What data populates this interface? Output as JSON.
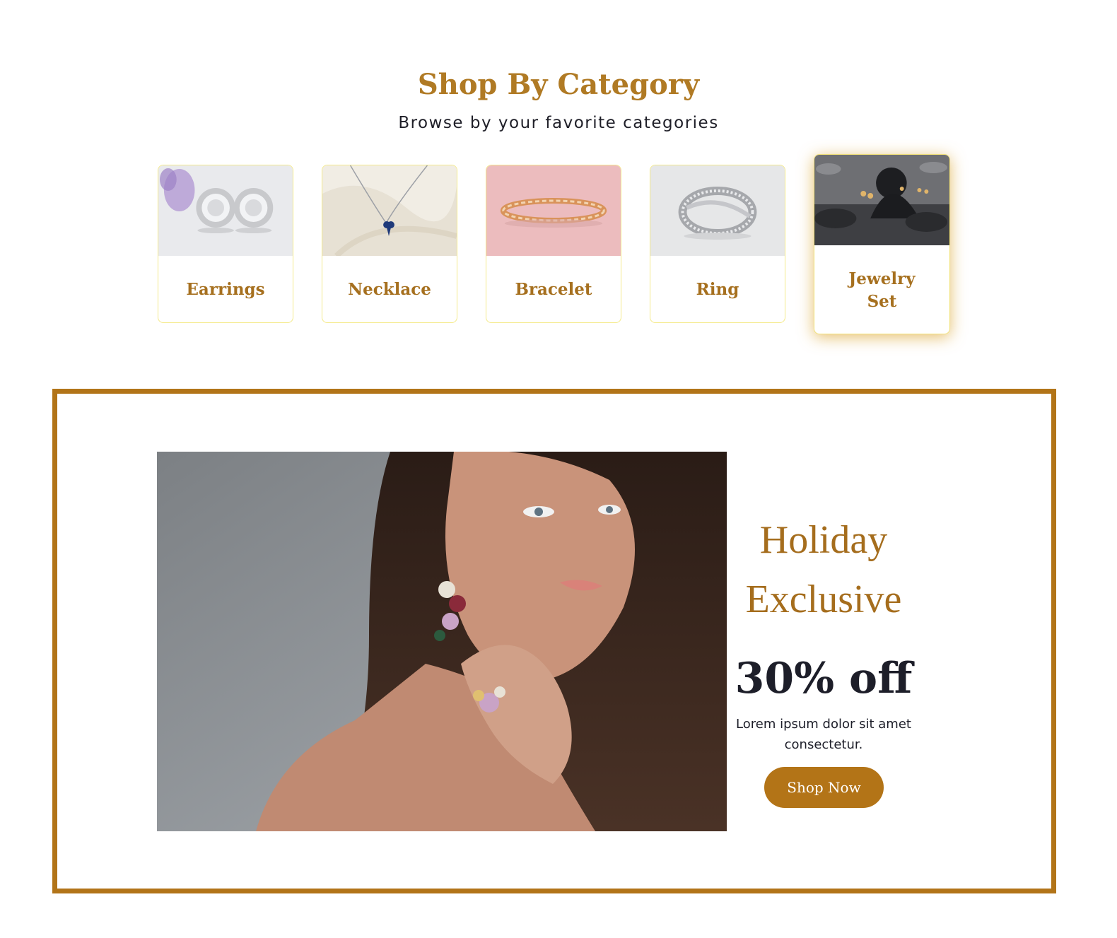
{
  "section": {
    "title": "Shop By Category",
    "subtitle": "Browse by your favorite categories"
  },
  "categories": [
    {
      "label": "Earrings",
      "image": "earrings-photo"
    },
    {
      "label": "Necklace",
      "image": "necklace-photo"
    },
    {
      "label": "Bracelet",
      "image": "bracelet-photo"
    },
    {
      "label": "Ring",
      "image": "ring-photo"
    },
    {
      "label": "Jewelry Set",
      "image": "jewelry-set-photo",
      "active": true
    }
  ],
  "promo": {
    "headline_line1": "Holiday",
    "headline_line2": "Exclusive",
    "discount": "30% off",
    "description": "Lorem ipsum dolor sit amet consectetur.",
    "button_label": "Shop Now",
    "image": "model-wearing-jewelry-photo"
  },
  "colors": {
    "accent": "#b27418",
    "heading_gold": "#b07a24",
    "card_border": "#f4ea8a",
    "dark_text": "#1d1e29"
  }
}
